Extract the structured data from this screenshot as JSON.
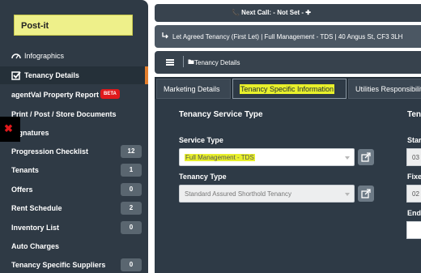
{
  "sidebar": {
    "postit_label": "Post-it",
    "items": [
      {
        "label": "Infographics",
        "icon": "chart-gauge-icon"
      },
      {
        "label": "Tenancy Details",
        "icon": "checkbox-icon",
        "active": true
      },
      {
        "label": "agentVal Property Report",
        "tag": "BETA"
      },
      {
        "label": "Print / Post / Store Documents"
      },
      {
        "label": "Signatures"
      },
      {
        "label": "Progression Checklist",
        "badge": "12"
      },
      {
        "label": "Tenants",
        "badge": "1"
      },
      {
        "label": "Offers",
        "badge": "0"
      },
      {
        "label": "Rent Schedule",
        "badge": "2"
      },
      {
        "label": "Inventory List",
        "badge": "0"
      },
      {
        "label": "Auto Charges"
      },
      {
        "label": "Tenancy Specific Suppliers",
        "badge": "0"
      }
    ],
    "close_glyph": "✖"
  },
  "topbar": {
    "text": "📞 Next Call: - Not Set - ✚"
  },
  "propbar": {
    "text": "Let Agreed Tenancy (First Let)  |  Full Management - TDS | 40 Angus St, CF3 3LH"
  },
  "breadcrumb": {
    "text": "Tenancy Details"
  },
  "tabs": [
    {
      "label": "Marketing Details"
    },
    {
      "label": "Tenancy Specific Information",
      "active": true
    },
    {
      "label": "Utilities Responsibility"
    }
  ],
  "section": {
    "title": "Tenancy Service Type",
    "title_right": "Tena"
  },
  "fields": {
    "service_type": {
      "label": "Service Type",
      "value": "Full Management - TDS"
    },
    "tenancy_type": {
      "label": "Tenancy Type",
      "value": "Standard Assured Shorthold Tenancy"
    },
    "right_1": {
      "label": "Star",
      "value": "03"
    },
    "right_2": {
      "label": "Fixe",
      "value": "02"
    },
    "right_3": {
      "label": "End"
    }
  },
  "colors": {
    "highlight": "#e8f02b",
    "active_border": "#e37e2c",
    "beta": "#e0191c"
  }
}
